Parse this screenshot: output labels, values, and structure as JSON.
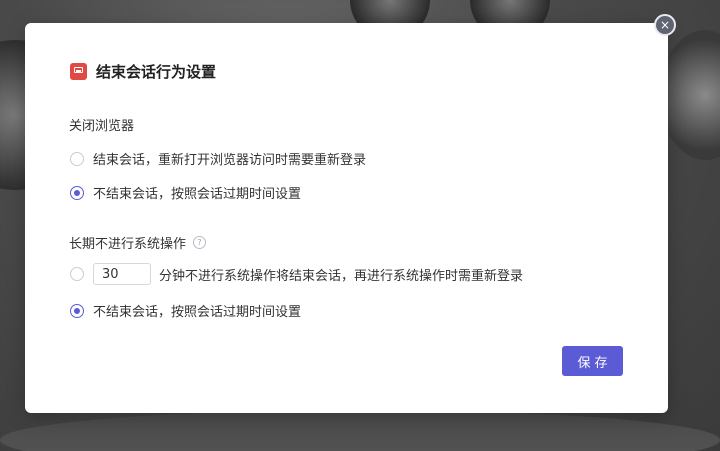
{
  "dialog": {
    "title": "结束会话行为设置",
    "close_label": "×",
    "browser_close": {
      "label": "关闭浏览器",
      "options": [
        {
          "label": "结束会话，重新打开浏览器访问时需要重新登录",
          "checked": false
        },
        {
          "label": "不结束会话，按照会话过期时间设置",
          "checked": true
        }
      ]
    },
    "idle": {
      "label": "长期不进行系统操作",
      "help": "?",
      "minutes_value": "30",
      "timeout_label": "分钟不进行系统操作将结束会话，再进行系统操作时需重新登录",
      "timeout_checked": false,
      "keep_label": "不结束会话，按照会话过期时间设置",
      "keep_checked": true
    },
    "save_label": "保存"
  },
  "colors": {
    "accent": "#5b5bd6",
    "title_icon": "#e04a43"
  }
}
